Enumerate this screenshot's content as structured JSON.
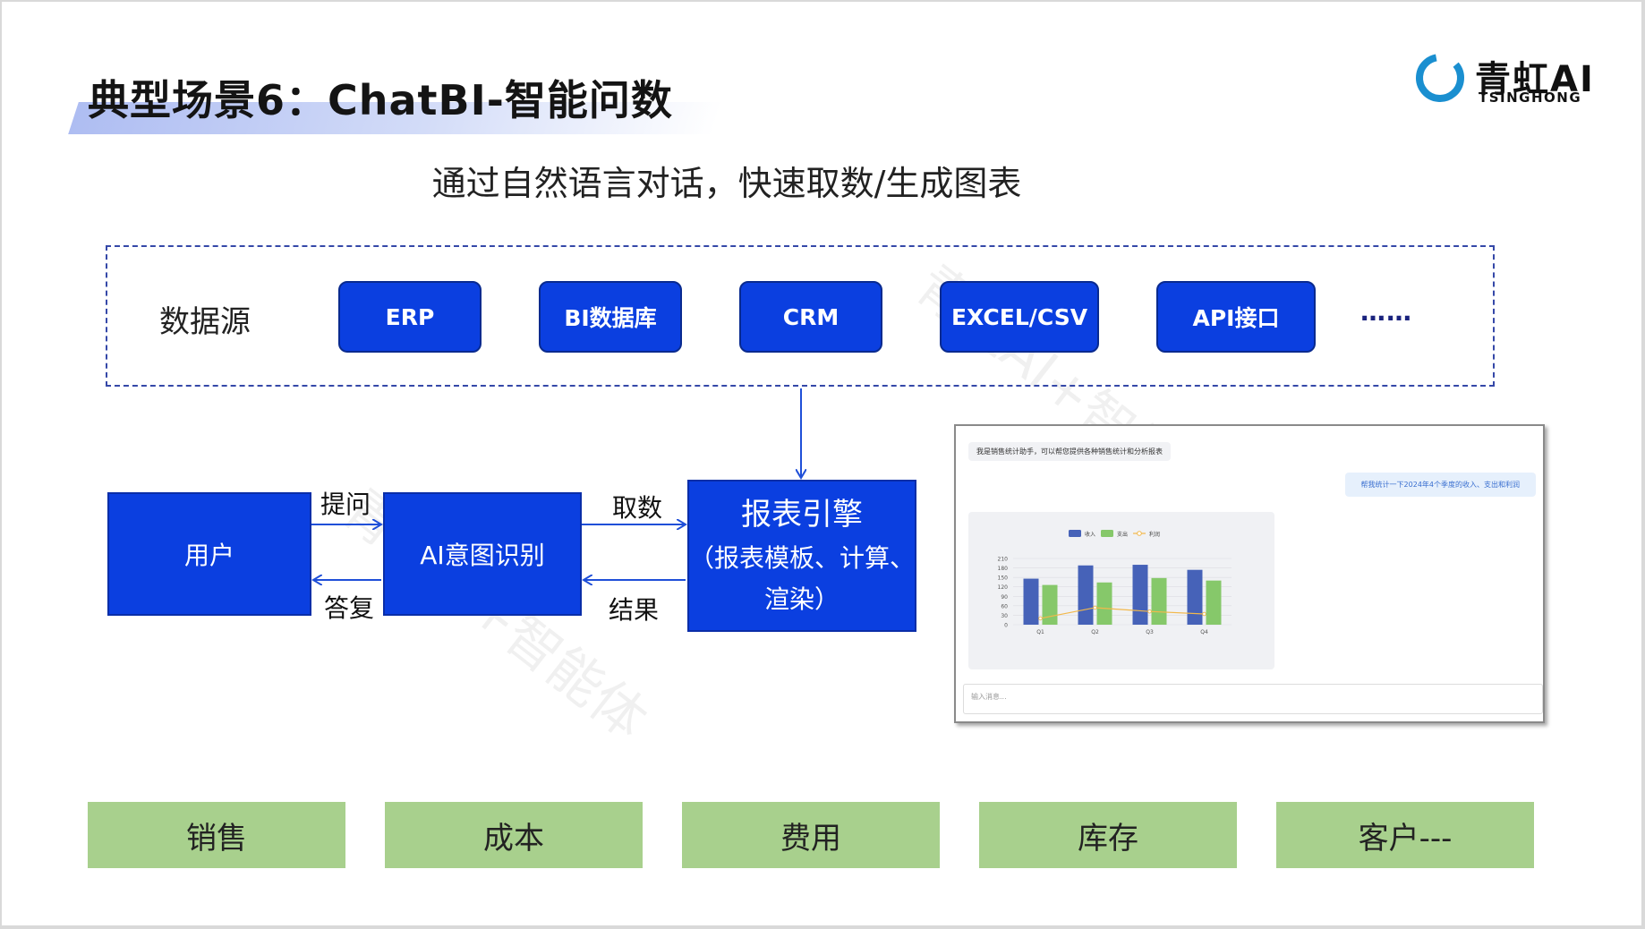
{
  "header": {
    "title": "典型场景6：ChatBI-智能问数",
    "subtitle": "通过自然语言对话，快速取数/生成图表"
  },
  "logo": {
    "name_cn": "青虹AI",
    "name_en": "TSINGHONG",
    "brand_color": "#1a8fd0"
  },
  "data_sources": {
    "label": "数据源",
    "items": [
      "ERP",
      "BI数据库",
      "CRM",
      "EXCEL/CSV",
      "API接口"
    ],
    "more": "……"
  },
  "flow": {
    "user": "用户",
    "ai_intent": "AI意图识别",
    "report_engine": {
      "title": "报表引擎",
      "line2": "（报表模板、计算、",
      "line3": "渲染）"
    },
    "ask": "提问",
    "reply": "答复",
    "fetch": "取数",
    "result": "结果"
  },
  "chat_demo": {
    "assistant_greeting": "我是销售统计助手，可以帮您提供各种销售统计和分析报表",
    "user_question": "帮我统计一下2024年4个季度的收入、支出和利润",
    "input_placeholder": "输入消息..."
  },
  "chart_data": {
    "type": "bar",
    "categories": [
      "Q1",
      "Q2",
      "Q3",
      "Q4"
    ],
    "series": [
      {
        "name": "收入",
        "type": "bar",
        "color": "#4662b8",
        "values": [
          146,
          188,
          190,
          174
        ]
      },
      {
        "name": "支出",
        "type": "bar",
        "color": "#86c86a",
        "values": [
          126,
          134,
          148,
          140
        ]
      },
      {
        "name": "利润",
        "type": "line",
        "color": "#f2b84b",
        "values": [
          20,
          54,
          42,
          34
        ]
      }
    ],
    "yticks": [
      "210",
      "180",
      "150",
      "120",
      "90",
      "60",
      "30",
      "0"
    ],
    "ylim": [
      0,
      210
    ],
    "legend_position": "top",
    "grid": true
  },
  "categories": [
    "销售",
    "成本",
    "费用",
    "库存",
    "客户---"
  ],
  "watermark": "青虹AI+智能体",
  "colors": {
    "primary_blue": "#0b3fe0",
    "category_green": "#a8d08d",
    "dash_border": "#3548a8"
  }
}
